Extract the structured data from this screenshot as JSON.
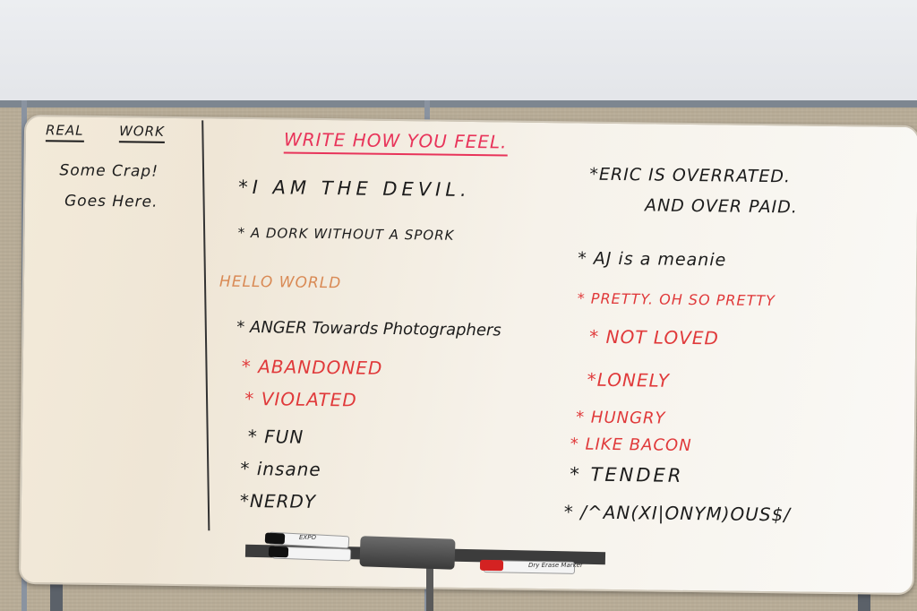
{
  "board": {
    "left_column": {
      "heading_1": "REAL",
      "heading_2": "WORK",
      "line_1": "Some Crap!",
      "line_2": "Goes Here."
    },
    "title": "WRITE HOW YOU FEEL.",
    "middle_items": [
      {
        "text": "*I AM THE DEVIL.",
        "color": "#1c1c1c"
      },
      {
        "text": "* A DORK WITHOUT A SPORK",
        "color": "#1c1c1c"
      },
      {
        "text": "HELLO WORLD",
        "color": "#d98a55"
      },
      {
        "text": "* ANGER Towards Photographers",
        "color": "#1c1c1c"
      },
      {
        "text": "* ABANDONED",
        "color": "#e0393a"
      },
      {
        "text": "* VIOLATED",
        "color": "#e0393a"
      },
      {
        "text": "* FUN",
        "color": "#1c1c1c"
      },
      {
        "text": "* insane",
        "color": "#1c1c1c"
      },
      {
        "text": "*NERDY",
        "color": "#1c1c1c"
      }
    ],
    "right_items": [
      {
        "text": "*ERIC IS OVERRATED.",
        "color": "#1c1c1c"
      },
      {
        "text": "AND OVER PAID.",
        "color": "#1c1c1c"
      },
      {
        "text": "* AJ is a meanie",
        "color": "#1c1c1c"
      },
      {
        "text": "* PRETTY. OH SO PRETTY",
        "color": "#e0393a"
      },
      {
        "text": "* NOT LOVED",
        "color": "#e0393a"
      },
      {
        "text": "*LONELY",
        "color": "#e0393a"
      },
      {
        "text": "* HUNGRY",
        "color": "#e0393a"
      },
      {
        "text": "* LIKE BACON",
        "color": "#e0393a"
      },
      {
        "text": "* TENDER",
        "color": "#1c1c1c"
      },
      {
        "text": "* /^AN(XI|ONYM)OUS$/",
        "color": "#1c1c1c"
      }
    ]
  },
  "tray": {
    "marker_brand": "EXPO",
    "red_marker_label": "Dry Erase Marker"
  }
}
